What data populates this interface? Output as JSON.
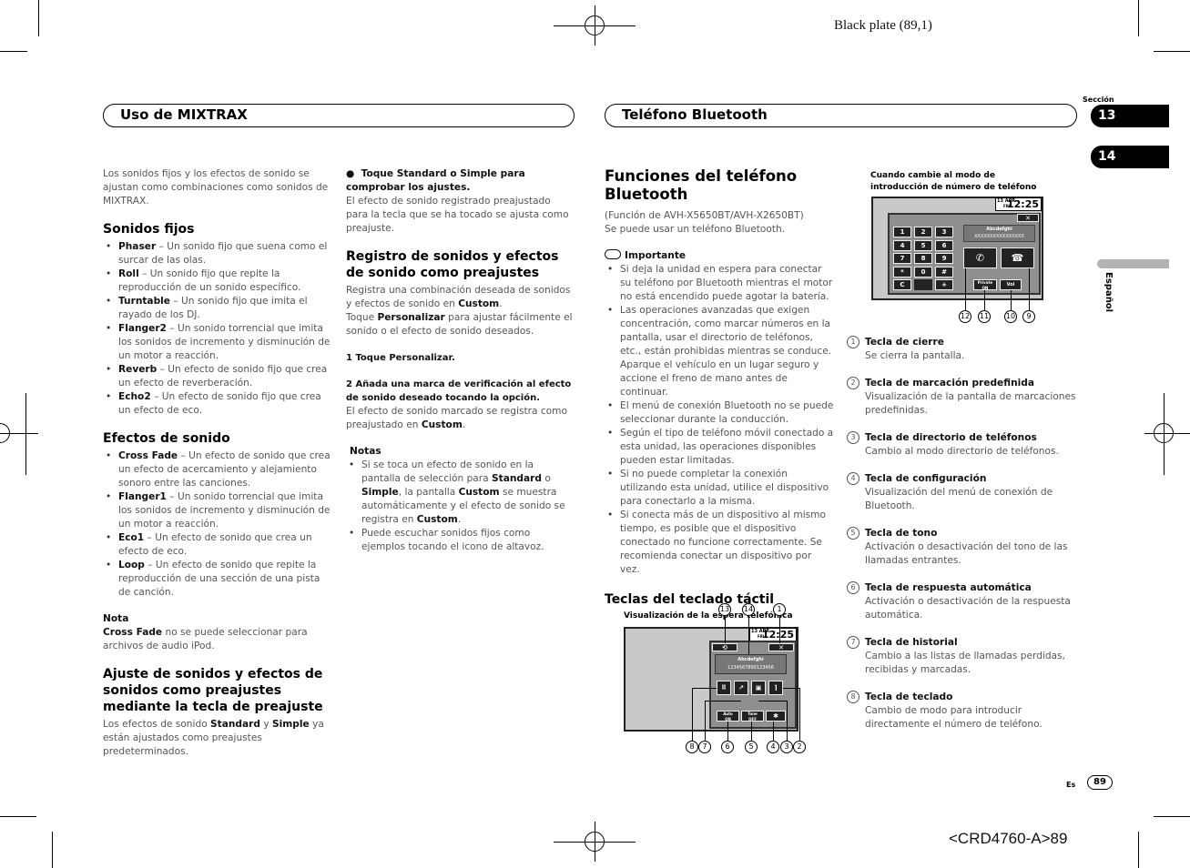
{
  "page": {
    "plate": "Black plate (89,1)",
    "code": "<CRD4760-A>89",
    "lang_code": "Es",
    "page_number": "89"
  },
  "sidebar": {
    "section_label": "Sección",
    "sections": [
      "13",
      "14"
    ],
    "language": "Español"
  },
  "banners": {
    "left": "Uso de MIXTRAX",
    "right": "Teléfono Bluetooth"
  },
  "col1": {
    "intro": "Los sonidos fijos y los efectos de sonido se ajustan como combinaciones como sonidos de MIXTRAX.",
    "fixed_title": "Sonidos fijos",
    "fixed_items": [
      {
        "name": "Phaser",
        "desc": " – Un sonido fijo que suena como el surcar de las olas."
      },
      {
        "name": "Roll",
        "desc": " – Un sonido fijo que repite la reproducción de un sonido específico."
      },
      {
        "name": "Turntable",
        "desc": " – Un sonido fijo que imita el rayado de los DJ."
      },
      {
        "name": "Flanger2",
        "desc": " – Un sonido torrencial que imita los sonidos de incremento y disminución de un motor a reacción."
      },
      {
        "name": "Reverb",
        "desc": " – Un efecto de sonido fijo que crea un efecto de reverberación."
      },
      {
        "name": "Echo2",
        "desc": " – Un efecto de sonido fijo que crea un efecto de eco."
      }
    ],
    "effects_title": "Efectos de sonido",
    "effects_items": [
      {
        "name": "Cross Fade",
        "desc": " – Un efecto de sonido que crea un efecto de acercamiento y alejamiento sonoro entre las canciones."
      },
      {
        "name": "Flanger1",
        "desc": " – Un sonido torrencial que imita los sonidos de incremento y disminución de un motor a reacción."
      },
      {
        "name": "Eco1",
        "desc": " – Un efecto de sonido que crea un efecto de eco."
      },
      {
        "name": "Loop",
        "desc": " – Un efecto de sonido que repite la reproducción de una sección de una pista de canción."
      }
    ],
    "note_title": "Nota",
    "note_bold": "Cross Fade",
    "note_text": " no se puede seleccionar para archivos de audio iPod.",
    "preset_title": "Ajuste de sonidos y efectos de sonidos como preajustes mediante la tecla de preajuste",
    "preset_text_1": "Los efectos de sonido ",
    "preset_bold_1": "Standard",
    "preset_text_2": " y ",
    "preset_bold_2": "Simple",
    "preset_text_3": " ya están ajustados como preajustes predeterminados."
  },
  "col2": {
    "check_heading": "Toque Standard o Simple para comprobar los ajustes.",
    "check_text": "El efecto de sonido registrado preajustado para la tecla que se ha tocado se ajusta como preajuste.",
    "register_title": "Registro de sonidos y efectos de sonido como preajustes",
    "register_text_1": "Registra una combinación deseada de sonidos y efectos de sonido en ",
    "register_bold_1": "Custom",
    "register_text_2": ".",
    "register_text_3": "Toque ",
    "register_bold_2": "Personalizar",
    "register_text_4": " para ajustar fácilmente el sonido o el efecto de sonido deseados.",
    "step1": "1    Toque Personalizar.",
    "step2": "2    Añada una marca de verificación al efecto de sonido deseado tocando la opción.",
    "step2_text_1": "El efecto de sonido marcado se registra como preajustado en ",
    "step2_bold": "Custom",
    "step2_text_2": ".",
    "notes_title": "Notas",
    "note1_a": "Si se toca un efecto de sonido en la pantalla de selección para ",
    "note1_b": "Standard",
    "note1_c": " o ",
    "note1_d": "Simple",
    "note1_e": ", la pantalla ",
    "note1_f": "Custom",
    "note1_g": " se muestra automáticamente y el efecto de sonido se registra en ",
    "note1_h": "Custom",
    "note1_i": ".",
    "note2": "Puede escuchar sonidos fijos como ejemplos tocando el icono de altavoz."
  },
  "col3": {
    "title": "Funciones del teléfono Bluetooth",
    "models": "(Función de AVH-X5650BT/AVH-X2650BT)",
    "intro": "Se puede usar un teléfono Bluetooth.",
    "important_title": "Importante",
    "important_items": [
      "Si deja la unidad en espera para conectar su teléfono por Bluetooth mientras el motor no está encendido puede agotar la batería.",
      "Las operaciones avanzadas que exigen concentración, como marcar números en la pantalla, usar el directorio de teléfonos, etc., están prohibidas mientras se conduce. Aparque el vehículo en un lugar seguro y accione el freno de mano antes de continuar.",
      "El menú de conexión Bluetooth no se puede seleccionar durante la conducción.",
      "Según el tipo de teléfono móvil conectado a esta unidad, las operaciones disponibles pueden estar limitadas.",
      "Si no puede completar la conexión utilizando esta unidad, utilice el dispositivo para conectarlo a la misma.",
      "Si conecta más de un dispositivo al mismo tiempo, es posible que el dispositivo conectado no funcione correctamente. Se recomienda conectar un dispositivo por vez."
    ],
    "keys_title": "Teclas del teclado táctil",
    "standby_caption": "Visualización de la espera telefónica",
    "standby_screen": {
      "date": "13 APR",
      "day": "FRI",
      "time": "12:25",
      "contact_name": "Abcdefghi",
      "contact_number": "1234567890123456",
      "auto_label": "Auto",
      "auto_state": "ON",
      "tone_label": "Tone",
      "tone_state": "OFF",
      "close_label": "✕",
      "callouts_top": [
        "13",
        "14",
        "1"
      ],
      "callouts_bottom": [
        "8",
        "7",
        "6",
        "5",
        "4",
        "3",
        "2"
      ]
    }
  },
  "col4": {
    "dial_caption": "Cuando cambie al modo de introducción de número de teléfono",
    "dial_screen": {
      "date": "13 APR",
      "day": "FRI",
      "time": "12:25",
      "contact_name": "Abcdefghi",
      "contact_number": "XXXXXXXXXXXXXXXX",
      "keys": [
        "1",
        "2",
        "3",
        "4",
        "5",
        "6",
        "7",
        "8",
        "9",
        "*",
        "0",
        "#",
        "C",
        "",
        "+"
      ],
      "private_label": "Private",
      "private_state": "ON",
      "vol_label": "Vol",
      "close_label": "✕",
      "callouts": [
        "12",
        "11",
        "10",
        "9"
      ]
    },
    "items": [
      {
        "num": "1",
        "title": "Tecla de cierre",
        "desc": "Se cierra la pantalla."
      },
      {
        "num": "2",
        "title": "Tecla de marcación predefinida",
        "desc": "Visualización de la pantalla de marcaciones predefinidas."
      },
      {
        "num": "3",
        "title": "Tecla de directorio de teléfonos",
        "desc": "Cambio al modo directorio de teléfonos."
      },
      {
        "num": "4",
        "title": "Tecla de configuración",
        "desc": "Visualización del menú de conexión de Bluetooth."
      },
      {
        "num": "5",
        "title": "Tecla de tono",
        "desc": "Activación o desactivación del tono de las llamadas entrantes."
      },
      {
        "num": "6",
        "title": "Tecla de respuesta automática",
        "desc": "Activación o desactivación de la respuesta automática."
      },
      {
        "num": "7",
        "title": "Tecla de historial",
        "desc": "Cambio a las listas de llamadas perdidas, recibidas y marcadas."
      },
      {
        "num": "8",
        "title": "Tecla de teclado",
        "desc": "Cambio de modo para introducir directamente el número de teléfono."
      }
    ]
  }
}
